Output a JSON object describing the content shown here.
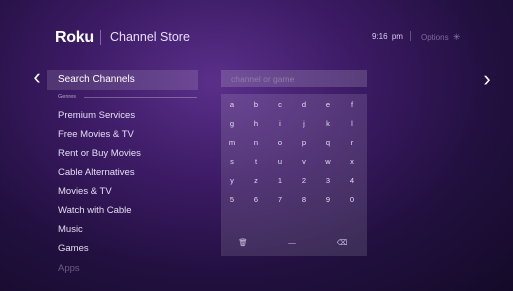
{
  "header": {
    "logo": "Roku",
    "title": "Channel Store",
    "time": "9:16",
    "ampm": "pm",
    "options_label": "Options",
    "options_icon": "✳"
  },
  "nav": {
    "left_arrow": "‹",
    "right_arrow": "›"
  },
  "menu": {
    "selected": "Search Channels",
    "section_label": "Genres",
    "items": [
      "Premium Services",
      "Free Movies & TV",
      "Rent or Buy Movies",
      "Cable Alternatives",
      "Movies & TV",
      "Watch with Cable",
      "Music",
      "Games",
      "Apps"
    ]
  },
  "search": {
    "placeholder": "channel or game",
    "value": ""
  },
  "keyboard": {
    "rows": [
      [
        "a",
        "b",
        "c",
        "d",
        "e",
        "f"
      ],
      [
        "g",
        "h",
        "i",
        "j",
        "k",
        "l"
      ],
      [
        "m",
        "n",
        "o",
        "p",
        "q",
        "r"
      ],
      [
        "s",
        "t",
        "u",
        "v",
        "w",
        "x"
      ],
      [
        "y",
        "z",
        "1",
        "2",
        "3",
        "4"
      ],
      [
        "5",
        "6",
        "7",
        "8",
        "9",
        "0"
      ]
    ],
    "bottom": [
      "🗑",
      "—",
      "⌫"
    ]
  },
  "colors": {
    "background_center": "#5a2f8a",
    "background_edge": "#140a28",
    "selection": "#ffffff22"
  }
}
